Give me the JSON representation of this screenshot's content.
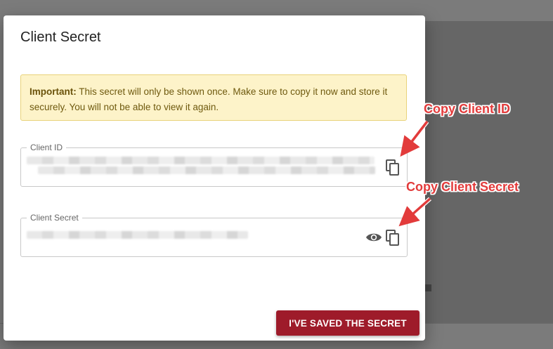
{
  "modal": {
    "title": "Client Secret",
    "alert": {
      "bold": "Important:",
      "text": " This secret will only be shown once. Make sure to copy it now and store it securely. You will not be able to view it again."
    },
    "client_id": {
      "label": "Client ID",
      "copy_icon": "copy-icon"
    },
    "client_secret": {
      "label": "Client Secret",
      "reveal_icon": "eye-icon",
      "copy_icon": "copy-icon"
    },
    "confirm_button": "I'VE SAVED THE SECRET"
  },
  "annotations": {
    "copy_client_id": "Copy Client ID",
    "copy_client_secret": "Copy Client Secret",
    "color": "#e23b3b"
  }
}
